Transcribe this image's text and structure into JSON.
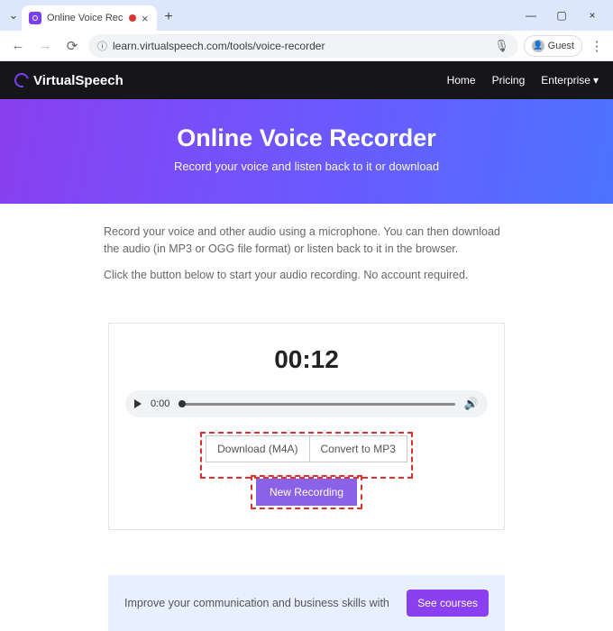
{
  "browser": {
    "tab_title": "Online Voice Recorder: R",
    "url": "learn.virtualspeech.com/tools/voice-recorder",
    "guest_label": "Guest"
  },
  "header": {
    "brand": "VirtualSpeech",
    "nav": {
      "home": "Home",
      "pricing": "Pricing",
      "enterprise": "Enterprise"
    }
  },
  "hero": {
    "title": "Online Voice Recorder",
    "subtitle": "Record your voice and listen back to it or download"
  },
  "intro": {
    "p1": "Record your voice and other audio using a microphone. You can then download the audio (in MP3 or OGG file format) or listen back to it in the browser.",
    "p2": "Click the button below to start your audio recording. No account required."
  },
  "recorder": {
    "timer": "00:12",
    "audio_time": "0:00",
    "download_label": "Download (M4A)",
    "convert_label": "Convert to MP3",
    "new_recording_label": "New Recording"
  },
  "promo": {
    "text": "Improve your communication and business skills with",
    "cta": "See courses"
  }
}
